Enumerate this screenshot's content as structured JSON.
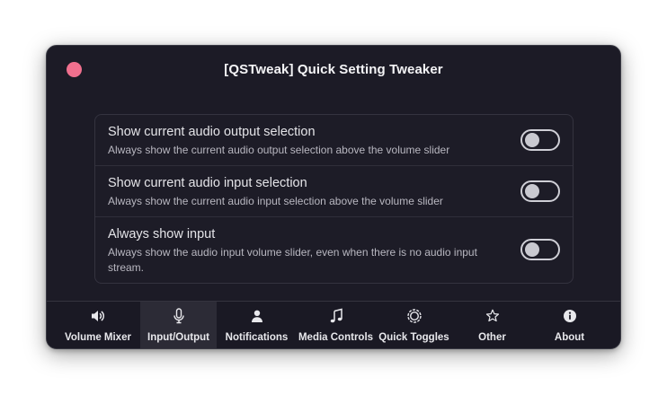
{
  "window": {
    "title": "[QSTweak] Quick Setting Tweaker"
  },
  "settings": {
    "rows": [
      {
        "title": "Show current audio output selection",
        "subtitle": "Always show the current audio output selection above the volume slider",
        "enabled": false
      },
      {
        "title": "Show current audio input selection",
        "subtitle": "Always show the current audio input selection above the volume slider",
        "enabled": false
      },
      {
        "title": "Always show input",
        "subtitle": "Always show the audio input volume slider, even when there is no audio input stream.",
        "enabled": false
      }
    ]
  },
  "nav": {
    "active": "Input/Output",
    "tabs": [
      {
        "label": "Volume Mixer",
        "icon": "speaker-icon"
      },
      {
        "label": "Input/Output",
        "icon": "microphone-icon"
      },
      {
        "label": "Notifications",
        "icon": "person-icon"
      },
      {
        "label": "Media Controls",
        "icon": "music-note-icon"
      },
      {
        "label": "Quick Toggles",
        "icon": "toggles-icon"
      },
      {
        "label": "Other",
        "icon": "star-icon"
      },
      {
        "label": "About",
        "icon": "info-icon"
      }
    ]
  },
  "colors": {
    "close_button": "#f0708e",
    "window_bg": "#1c1b26",
    "active_tab_bg": "#2c2b36"
  }
}
